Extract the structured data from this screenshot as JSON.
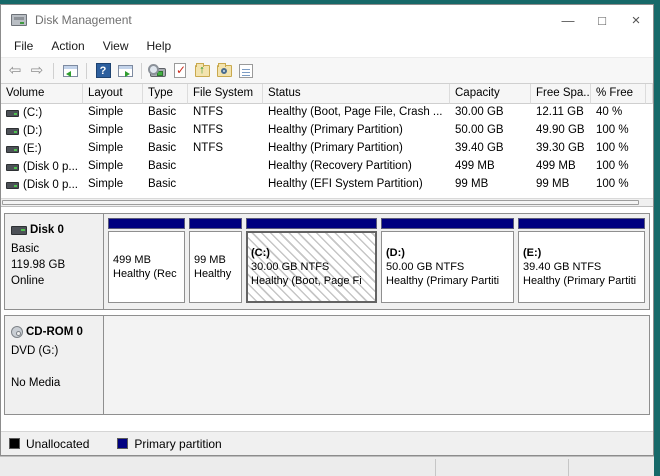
{
  "colors": {
    "desktop_teal": "#166969",
    "partition_header_navy": "#000080",
    "unallocated_black": "#000000",
    "window_bg": "#f0f0f0"
  },
  "window": {
    "title": "Disk Management",
    "controls": {
      "minimize": "—",
      "maximize": "□",
      "close": "×"
    }
  },
  "menu": {
    "items": [
      "File",
      "Action",
      "View",
      "Help"
    ]
  },
  "toolbar": {
    "glyphs": {
      "back": "⇦",
      "forward": "⇨",
      "help": "?",
      "check": "✓",
      "up": "↑"
    }
  },
  "volume_list": {
    "columns": [
      "Volume",
      "Layout",
      "Type",
      "File System",
      "Status",
      "Capacity",
      "Free Spa...",
      "% Free"
    ],
    "rows": [
      {
        "volume": "(C:)",
        "layout": "Simple",
        "type": "Basic",
        "fs": "NTFS",
        "status": "Healthy (Boot, Page File, Crash ...",
        "capacity": "30.00 GB",
        "free": "12.11 GB",
        "pct": "40 %"
      },
      {
        "volume": "(D:)",
        "layout": "Simple",
        "type": "Basic",
        "fs": "NTFS",
        "status": "Healthy (Primary Partition)",
        "capacity": "50.00 GB",
        "free": "49.90 GB",
        "pct": "100 %"
      },
      {
        "volume": "(E:)",
        "layout": "Simple",
        "type": "Basic",
        "fs": "NTFS",
        "status": "Healthy (Primary Partition)",
        "capacity": "39.40 GB",
        "free": "39.30 GB",
        "pct": "100 %"
      },
      {
        "volume": "(Disk 0 p...",
        "layout": "Simple",
        "type": "Basic",
        "fs": "",
        "status": "Healthy (Recovery Partition)",
        "capacity": "499 MB",
        "free": "499 MB",
        "pct": "100 %"
      },
      {
        "volume": "(Disk 0 p...",
        "layout": "Simple",
        "type": "Basic",
        "fs": "",
        "status": "Healthy (EFI System Partition)",
        "capacity": "99 MB",
        "free": "99 MB",
        "pct": "100 %"
      }
    ]
  },
  "graphic": {
    "disk0": {
      "name": "Disk 0",
      "type": "Basic",
      "size": "119.98 GB",
      "status": "Online",
      "partitions": [
        {
          "size": "499 MB",
          "status": "Healthy (Rec"
        },
        {
          "size": "99 MB",
          "status": "Healthy"
        },
        {
          "label": "(C:)",
          "size": "30.00 GB NTFS",
          "status": "Healthy (Boot, Page Fi"
        },
        {
          "label": "(D:)",
          "size": "50.00 GB NTFS",
          "status": "Healthy (Primary Partiti"
        },
        {
          "label": "(E:)",
          "size": "39.40 GB NTFS",
          "status": "Healthy (Primary Partiti"
        }
      ]
    },
    "cdrom": {
      "name": "CD-ROM 0",
      "drive": "DVD (G:)",
      "media": "No Media"
    }
  },
  "legend": {
    "items": [
      {
        "label": "Unallocated",
        "color": "#000000"
      },
      {
        "label": "Primary partition",
        "color": "#000080"
      }
    ]
  }
}
